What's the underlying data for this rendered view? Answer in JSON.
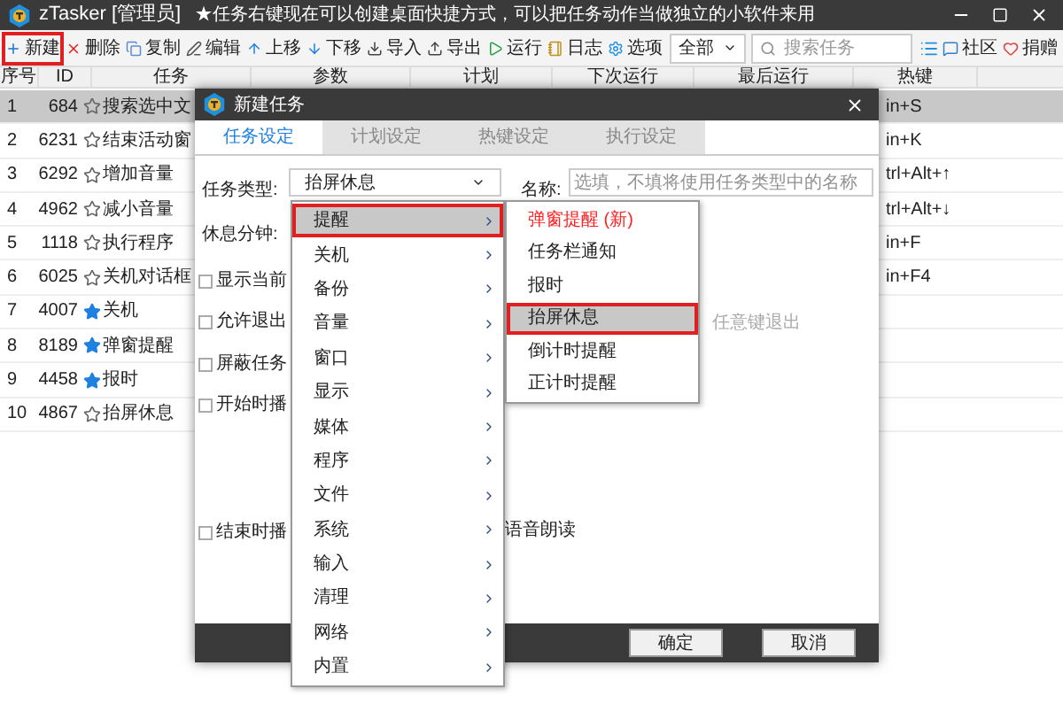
{
  "window": {
    "title": "zTasker [管理员]",
    "notice": "★任务右键现在可以创建桌面快捷方式，可以把任务动作当做独立的小软件来用"
  },
  "toolbar": {
    "buttons": [
      {
        "label": "新建",
        "kind": "new",
        "selected": true
      },
      {
        "label": "删除",
        "kind": "delete",
        "selected": false
      },
      {
        "label": "复制",
        "kind": "copy",
        "selected": false
      },
      {
        "label": "编辑",
        "kind": "edit",
        "selected": false
      },
      {
        "label": "上移",
        "kind": "up",
        "selected": false
      },
      {
        "label": "下移",
        "kind": "down",
        "selected": false
      },
      {
        "label": "导入",
        "kind": "import",
        "selected": false
      },
      {
        "label": "导出",
        "kind": "export",
        "selected": false
      },
      {
        "label": "运行",
        "kind": "run",
        "selected": false
      },
      {
        "label": "日志",
        "kind": "log",
        "selected": false
      },
      {
        "label": "选项",
        "kind": "options",
        "selected": false
      }
    ],
    "filter": "全部",
    "search_placeholder": "搜索任务",
    "right_buttons": [
      {
        "label": "社区",
        "kind": "community"
      },
      {
        "label": "捐赠",
        "kind": "donate"
      }
    ]
  },
  "table": {
    "columns": [
      "序号",
      "ID",
      "任务",
      "参数",
      "计划",
      "下次运行",
      "最后运行",
      "热键"
    ],
    "rows": [
      {
        "no": "1",
        "id": "684",
        "starred": false,
        "task": "搜索选中文",
        "hotkey": "in+S",
        "selected": true
      },
      {
        "no": "2",
        "id": "6231",
        "starred": false,
        "task": "结束活动窗",
        "hotkey": "in+K",
        "selected": false
      },
      {
        "no": "3",
        "id": "6292",
        "starred": false,
        "task": "增加音量",
        "hotkey": "trl+Alt+↑",
        "selected": false
      },
      {
        "no": "4",
        "id": "4962",
        "starred": false,
        "task": "减小音量",
        "hotkey": "trl+Alt+↓",
        "selected": false
      },
      {
        "no": "5",
        "id": "1118",
        "starred": false,
        "task": "执行程序",
        "hotkey": "in+F",
        "selected": false
      },
      {
        "no": "6",
        "id": "6025",
        "starred": false,
        "task": "关机对话框",
        "hotkey": "in+F4",
        "selected": false
      },
      {
        "no": "7",
        "id": "4007",
        "starred": true,
        "task": "关机",
        "hotkey": "",
        "selected": false
      },
      {
        "no": "8",
        "id": "8189",
        "starred": true,
        "task": "弹窗提醒",
        "hotkey": "",
        "selected": false
      },
      {
        "no": "9",
        "id": "4458",
        "starred": true,
        "task": "报时",
        "hotkey": "",
        "selected": false
      },
      {
        "no": "10",
        "id": "4867",
        "starred": false,
        "task": "抬屏休息",
        "hotkey": "",
        "selected": false
      }
    ]
  },
  "dialog": {
    "title": "新建任务",
    "tabs": [
      {
        "label": "任务设定",
        "selected": true
      },
      {
        "label": "计划设定",
        "selected": false
      },
      {
        "label": "热键设定",
        "selected": false
      },
      {
        "label": "执行设定",
        "selected": false
      }
    ],
    "task_type_label": "任务类型:",
    "task_type_value": "抬屏休息",
    "name_label": "名称:",
    "name_placeholder": "选填，不填将使用任务类型中的名称",
    "rest_minutes_label": "休息分钟:",
    "options": [
      {
        "label": "显示当前",
        "checked": false
      },
      {
        "label": "允许退出",
        "checked": false
      },
      {
        "label": "屏蔽任务",
        "checked": false
      },
      {
        "label": "开始时播",
        "checked": false
      },
      {
        "label": "结束时播",
        "checked": false
      }
    ],
    "exit_hint": "任意键退出",
    "voice_label": "语音朗读",
    "buttons": [
      "确定",
      "取消"
    ]
  },
  "menu": {
    "items": [
      {
        "label": "提醒",
        "selected": true
      },
      {
        "label": "关机",
        "selected": false
      },
      {
        "label": "备份",
        "selected": false
      },
      {
        "label": "音量",
        "selected": false
      },
      {
        "label": "窗口",
        "selected": false
      },
      {
        "label": "显示",
        "selected": false
      },
      {
        "label": "媒体",
        "selected": false
      },
      {
        "label": "程序",
        "selected": false
      },
      {
        "label": "文件",
        "selected": false
      },
      {
        "label": "系统",
        "selected": false
      },
      {
        "label": "输入",
        "selected": false
      },
      {
        "label": "清理",
        "selected": false
      },
      {
        "label": "网络",
        "selected": false
      },
      {
        "label": "内置",
        "selected": false
      }
    ],
    "submenu": [
      {
        "label": "弹窗提醒 (新)",
        "selected": false,
        "color": "#ff2020"
      },
      {
        "label": "任务栏通知",
        "selected": false
      },
      {
        "label": "报时",
        "selected": false
      },
      {
        "label": "抬屏休息",
        "selected": true
      },
      {
        "label": "倒计时提醒",
        "selected": false
      },
      {
        "label": "正计时提醒",
        "selected": false
      }
    ]
  }
}
